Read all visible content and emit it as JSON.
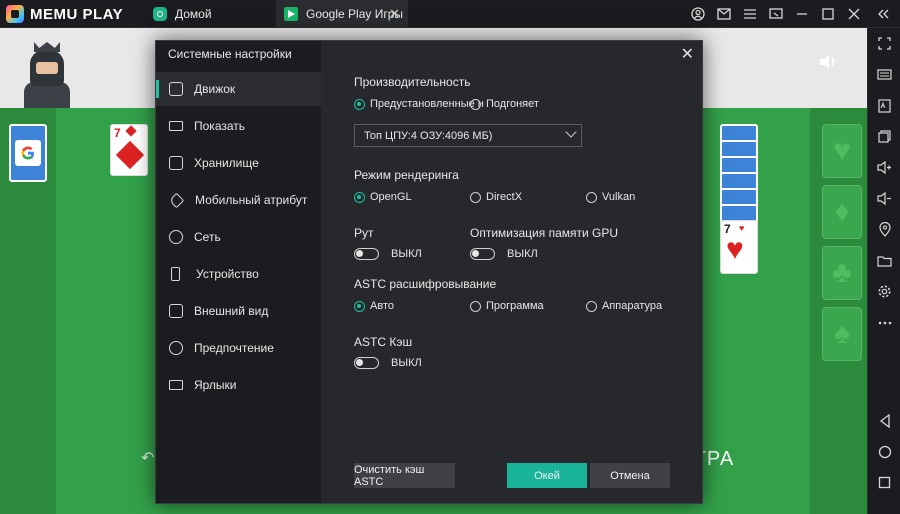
{
  "app": {
    "logo_text": "MEMU PLAY",
    "tabs": [
      {
        "label": "Домой"
      },
      {
        "label": "Google Play Игры"
      }
    ],
    "tab_close_glyph": "✕"
  },
  "game": {
    "bottom_text": "ГРА"
  },
  "dialog": {
    "title": "Системные настройки",
    "close_glyph": "✕",
    "nav": [
      {
        "label": "Движок",
        "icon": "engine-icon"
      },
      {
        "label": "Показать",
        "icon": "display-icon"
      },
      {
        "label": "Хранилище",
        "icon": "storage-icon"
      },
      {
        "label": "Мобильный атрибут",
        "icon": "tag-icon"
      },
      {
        "label": "Сеть",
        "icon": "globe-icon"
      },
      {
        "label": "Устройство",
        "icon": "phone-icon"
      },
      {
        "label": "Внешний вид",
        "icon": "window-icon"
      },
      {
        "label": "Предпочтение",
        "icon": "gear-icon"
      },
      {
        "label": "Ярлыки",
        "icon": "keyboard-icon"
      }
    ],
    "performance": {
      "title": "Производительность",
      "option_preset": "Предустановленные н",
      "option_custom": "Подгоняет",
      "selected": "preset",
      "select_value": "Топ ЦПУ:4 ОЗУ:4096 МБ)"
    },
    "render": {
      "title": "Режим рендеринга",
      "options": [
        "OpenGL",
        "DirectX",
        "Vulkan"
      ],
      "selected": "OpenGL"
    },
    "root": {
      "title": "Рут",
      "state": "ВЫКЛ"
    },
    "gpu_opt": {
      "title": "Оптимизация памяти GPU",
      "state": "ВЫКЛ"
    },
    "astc": {
      "title": "ASTC расшифровывание",
      "options": [
        "Авто",
        "Программа",
        "Аппаратура"
      ],
      "selected": "Авто"
    },
    "astc_cache": {
      "title": "ASTC Кэш",
      "state": "ВЫКЛ"
    },
    "buttons": {
      "clear_cache": "Очистить кэш ASTC",
      "ok": "Окей",
      "cancel": "Отмена"
    }
  },
  "colors": {
    "accent": "#19c1a5",
    "dialog_bg": "#26282c",
    "nav_bg": "#1b1c1f",
    "game_green": "#33a14a"
  }
}
